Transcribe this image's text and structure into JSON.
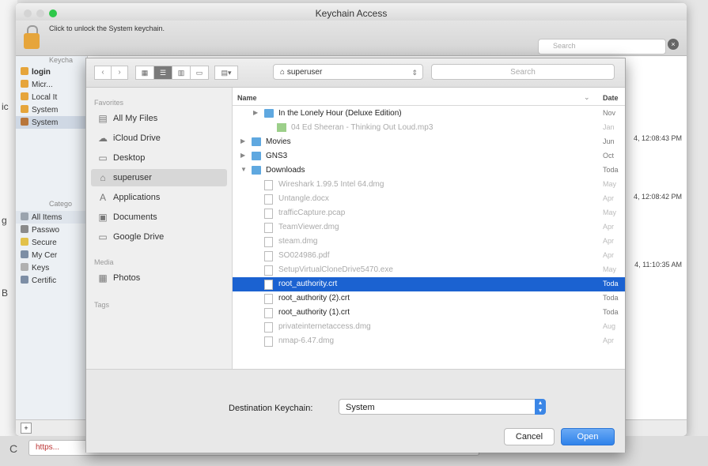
{
  "window": {
    "title": "Keychain Access",
    "unlock_text": "Click to unlock the System keychain.",
    "search_placeholder": "Search"
  },
  "keychains": {
    "header": "Keycha",
    "items": [
      {
        "label": "login",
        "icon": "lock-icon"
      },
      {
        "label": "Micr...",
        "icon": "lock-icon"
      },
      {
        "label": "Local It",
        "icon": "lock-icon"
      },
      {
        "label": "System",
        "icon": "lock-icon"
      },
      {
        "label": "System",
        "icon": "cabinet-icon"
      }
    ]
  },
  "categories": {
    "header": "Catego",
    "items": [
      {
        "label": "All Items",
        "icon": "all-items-icon"
      },
      {
        "label": "Passwo",
        "icon": "pen-icon"
      },
      {
        "label": "Secure",
        "icon": "note-icon"
      },
      {
        "label": "My Cer",
        "icon": "certificate-icon"
      },
      {
        "label": "Keys",
        "icon": "key-icon"
      },
      {
        "label": "Certific",
        "icon": "certificate-icon"
      }
    ]
  },
  "background_dates": [
    "4, 12:08:43 PM",
    "4, 12:08:42 PM",
    "4, 11:10:35 AM"
  ],
  "browser": {
    "url": "https..."
  },
  "dialog": {
    "location": "superuser",
    "search_placeholder": "Search",
    "sidebar": {
      "favorites_label": "Favorites",
      "favorites": [
        {
          "label": "All My Files",
          "icon": "all-files-icon"
        },
        {
          "label": "iCloud Drive",
          "icon": "cloud-icon"
        },
        {
          "label": "Desktop",
          "icon": "desktop-icon"
        },
        {
          "label": "superuser",
          "icon": "home-icon"
        },
        {
          "label": "Applications",
          "icon": "applications-icon"
        },
        {
          "label": "Documents",
          "icon": "documents-icon"
        },
        {
          "label": "Google Drive",
          "icon": "folder-icon"
        }
      ],
      "media_label": "Media",
      "media": [
        {
          "label": "Photos",
          "icon": "photos-icon"
        }
      ],
      "tags_label": "Tags"
    },
    "columns": {
      "name": "Name",
      "date": "Date"
    },
    "files": [
      {
        "name": "In the Lonely Hour (Deluxe Edition)",
        "date": "Nov",
        "kind": "folder",
        "indent": 1,
        "disclosure": "▶",
        "dim": false
      },
      {
        "name": "04 Ed Sheeran - Thinking Out Loud.mp3",
        "date": "Jan",
        "kind": "audio",
        "indent": 2,
        "disclosure": "",
        "dim": true
      },
      {
        "name": "Movies",
        "date": "Jun",
        "kind": "folder",
        "indent": 0,
        "disclosure": "▶",
        "dim": false
      },
      {
        "name": "GNS3",
        "date": "Oct",
        "kind": "folder",
        "indent": 0,
        "disclosure": "▶",
        "dim": false
      },
      {
        "name": "Downloads",
        "date": "Toda",
        "kind": "folder",
        "indent": 0,
        "disclosure": "▼",
        "dim": false
      },
      {
        "name": "Wireshark 1.99.5 Intel 64.dmg",
        "date": "May",
        "kind": "doc",
        "indent": 1,
        "disclosure": "",
        "dim": true
      },
      {
        "name": "Untangle.docx",
        "date": "Apr",
        "kind": "doc",
        "indent": 1,
        "disclosure": "",
        "dim": true
      },
      {
        "name": "trafficCapture.pcap",
        "date": "May",
        "kind": "doc",
        "indent": 1,
        "disclosure": "",
        "dim": true
      },
      {
        "name": "TeamViewer.dmg",
        "date": "Apr",
        "kind": "doc",
        "indent": 1,
        "disclosure": "",
        "dim": true
      },
      {
        "name": "steam.dmg",
        "date": "Apr",
        "kind": "doc",
        "indent": 1,
        "disclosure": "",
        "dim": true
      },
      {
        "name": "SO024986.pdf",
        "date": "Apr",
        "kind": "doc",
        "indent": 1,
        "disclosure": "",
        "dim": true
      },
      {
        "name": "SetupVirtualCloneDrive5470.exe",
        "date": "May",
        "kind": "doc",
        "indent": 1,
        "disclosure": "",
        "dim": true
      },
      {
        "name": "root_authority.crt",
        "date": "Toda",
        "kind": "doc",
        "indent": 1,
        "disclosure": "",
        "dim": false,
        "selected": true
      },
      {
        "name": "root_authority (2).crt",
        "date": "Toda",
        "kind": "doc",
        "indent": 1,
        "disclosure": "",
        "dim": false
      },
      {
        "name": "root_authority (1).crt",
        "date": "Toda",
        "kind": "doc",
        "indent": 1,
        "disclosure": "",
        "dim": false
      },
      {
        "name": "privateinternetaccess.dmg",
        "date": "Aug",
        "kind": "doc",
        "indent": 1,
        "disclosure": "",
        "dim": true
      },
      {
        "name": "nmap-6.47.dmg",
        "date": "Apr",
        "kind": "doc",
        "indent": 1,
        "disclosure": "",
        "dim": true
      }
    ],
    "destination_label": "Destination Keychain:",
    "destination_value": "System",
    "cancel_label": "Cancel",
    "open_label": "Open"
  }
}
